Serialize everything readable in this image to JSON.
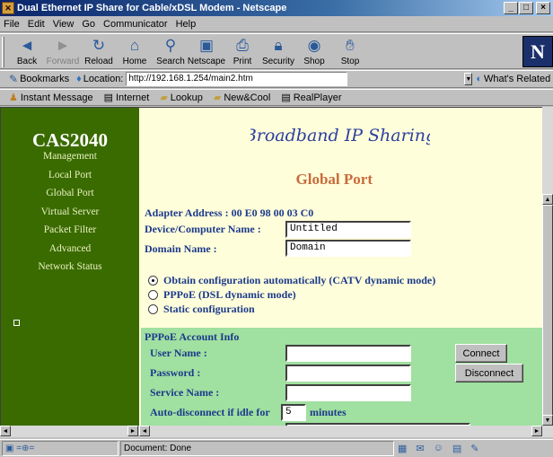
{
  "window": {
    "title": "Dual Ethernet IP Share for Cable/xDSL Modem - Netscape",
    "buttons": {
      "minimize": "_",
      "maximize": "□",
      "close": "×"
    }
  },
  "menu": [
    "File",
    "Edit",
    "View",
    "Go",
    "Communicator",
    "Help"
  ],
  "toolbar": [
    {
      "label": "Back",
      "icon": "back-arrow-icon",
      "glyph": "◄",
      "enabled": true
    },
    {
      "label": "Forward",
      "icon": "forward-arrow-icon",
      "glyph": "►",
      "enabled": false
    },
    {
      "label": "Reload",
      "icon": "reload-icon",
      "glyph": "↻",
      "enabled": true
    },
    {
      "label": "Home",
      "icon": "home-icon",
      "glyph": "⌂",
      "enabled": true
    },
    {
      "label": "Search",
      "icon": "search-icon",
      "glyph": "⚲",
      "enabled": true
    },
    {
      "label": "Netscape",
      "icon": "netscape-icon",
      "glyph": "▣",
      "enabled": true
    },
    {
      "label": "Print",
      "icon": "print-icon",
      "glyph": "⎙",
      "enabled": true
    },
    {
      "label": "Security",
      "icon": "lock-icon",
      "glyph": "🔒︎",
      "enabled": true
    },
    {
      "label": "Shop",
      "icon": "shop-icon",
      "glyph": "◉",
      "enabled": true
    },
    {
      "label": "Stop",
      "icon": "stop-icon",
      "glyph": "✋︎",
      "enabled": true
    }
  ],
  "logo": "N",
  "location": {
    "bookmarks_label": "Bookmarks",
    "location_label": "Location:",
    "url": "http://192.168.1.254/main2.htm",
    "related_label": "What's Related"
  },
  "personal_toolbar": [
    "Instant Message",
    "Internet",
    "Lookup",
    "New&Cool",
    "RealPlayer"
  ],
  "left_nav": {
    "brand": "CAS2040",
    "items": [
      "Management",
      "Local Port",
      "Global Port",
      "Virtual Server",
      "Packet Filter",
      "Advanced",
      "Network Status"
    ]
  },
  "page": {
    "banner": "Broadband IP Sharing",
    "heading": "Global Port",
    "adapter": "Adapter Address : 00 E0 98 00 03 C0",
    "device_label": "Device/Computer Name :",
    "device_value": "Untitled",
    "domain_label": "Domain Name :",
    "domain_value": "Domain",
    "options": [
      {
        "label": "Obtain configuration automatically (CATV dynamic mode)",
        "selected": true
      },
      {
        "label": "PPPoE (DSL dynamic mode)",
        "selected": false
      },
      {
        "label": "Static configuration",
        "selected": false
      }
    ],
    "pppoe": {
      "title": "PPPoE Account Info",
      "user_label": "User Name :",
      "password_label": "Password :",
      "service_label": "Service Name :",
      "idle_label": "Auto-disconnect if idle for",
      "idle_value": "5",
      "idle_unit": "minutes",
      "connect": "Connect",
      "disconnect": "Disconnect"
    }
  },
  "status": {
    "text": "Document: Done"
  }
}
